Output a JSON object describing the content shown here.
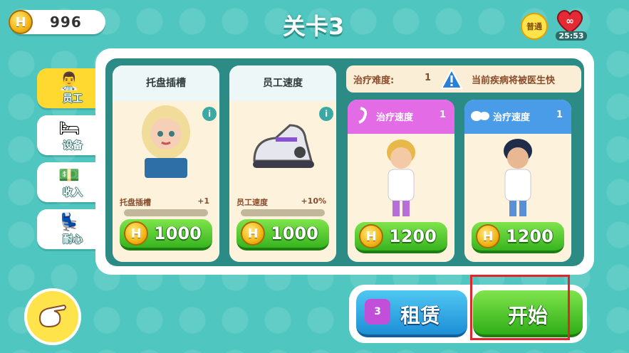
{
  "header": {
    "coins": "996",
    "coin_symbol": "H",
    "title": "关卡3",
    "difficulty_badge": "普通",
    "lives_timer": "25:53"
  },
  "tabs": [
    {
      "label": "员工",
      "icon": "staff-icon",
      "active": true
    },
    {
      "label": "设备",
      "icon": "equipment-icon",
      "active": false
    },
    {
      "label": "收入",
      "icon": "money-icon",
      "active": false
    },
    {
      "label": "耐心",
      "icon": "chair-icon",
      "active": false
    }
  ],
  "upgrades": [
    {
      "title": "托盘插槽",
      "stat_label": "托盘插槽",
      "stat_value": "+1",
      "price": "1000"
    },
    {
      "title": "员工速度",
      "stat_label": "员工速度",
      "stat_value": "+10%",
      "price": "1000"
    }
  ],
  "difficulty": {
    "label": "治疗难度:",
    "value": "1",
    "message": "当前疾病将被医生快"
  },
  "staff": [
    {
      "title": "治疗速度",
      "level": "1",
      "price": "1200",
      "color": "#e36be6"
    },
    {
      "title": "治疗速度",
      "level": "1",
      "price": "1200",
      "color": "#4a9be8"
    }
  ],
  "actions": {
    "rent_label": "租赁",
    "rent_badge": "3",
    "start_label": "开始"
  },
  "colors": {
    "background": "#4fc7c0",
    "panel_inner": "#2d8b86",
    "active_tab": "#ffd92f",
    "buy_button": "#38b41f",
    "highlight": "#e0262c"
  }
}
